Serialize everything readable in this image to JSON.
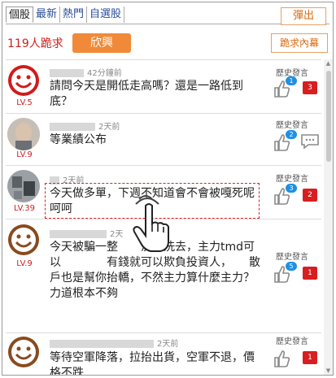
{
  "tabs": [
    {
      "label": "個股",
      "active": true
    },
    {
      "label": "最新",
      "active": false
    },
    {
      "label": "熱門",
      "active": false
    },
    {
      "label": "自選股",
      "active": false
    }
  ],
  "toolbar": {
    "popout_label": "彈出"
  },
  "summary": {
    "count_text": "119人跪求",
    "hot_label": "欣興",
    "inside_label": "跪求內幕"
  },
  "posts": [
    {
      "time": "42分鐘前",
      "level": "LV.5",
      "text": "請問今天是開低走高嗎？還是一路低到底？",
      "history": "歷史發言",
      "likes": "1",
      "replies": "3",
      "avatar": "smiley-avatar"
    },
    {
      "time": "2天前",
      "level": "LV.9",
      "text": "等業績公布",
      "history": "歷史發言",
      "likes": "2",
      "replies": "",
      "avatar": "photo-avatar"
    },
    {
      "time": "2天前",
      "level": "LV.39",
      "text": "今天做多單，下週不知道會不會被嘎死呢呵呵",
      "history": "歷史發言",
      "likes": "3",
      "replies": "2",
      "avatar": "photo-avatar"
    },
    {
      "time": "2天",
      "level": "LV.9",
      "text": "今天被騙一整　　洗來洗去，主力tmd可以　　　　有錢就可以欺負投資人，　　散戶也是幫你抬轎，不然主力算什麼主力？力道根本不夠",
      "history": "歷史發言",
      "likes": "5",
      "replies": "1",
      "avatar": "smiley-avatar"
    },
    {
      "time": "2天前",
      "level": "",
      "text": "等待空軍降落，拉抬出貨，空軍不退，價格不跌",
      "history": "歷史發言",
      "likes": "",
      "replies": "1",
      "avatar": "smiley-avatar"
    }
  ],
  "colors": {
    "accent": "#f08a38",
    "red": "#d81e1e",
    "blue": "#1e90e6",
    "link": "#2a4e9a"
  }
}
